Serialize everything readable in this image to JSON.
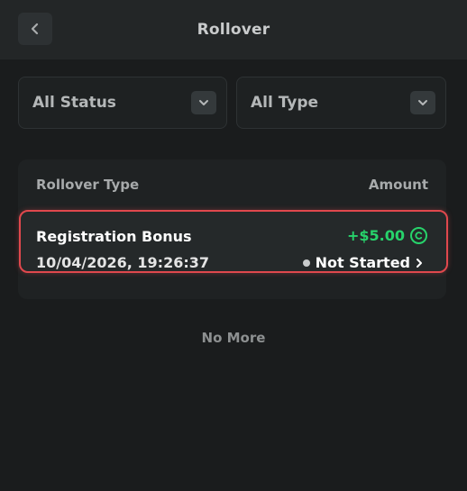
{
  "header": {
    "title": "Rollover",
    "back_icon": "chevron-left-icon"
  },
  "filters": {
    "status": {
      "value": "All Status",
      "icon": "chevron-down-icon"
    },
    "type": {
      "value": "All Type",
      "icon": "chevron-down-icon"
    }
  },
  "table": {
    "columns": [
      "Rollover Type",
      "Amount"
    ],
    "rows": [
      {
        "title": "Registration Bonus",
        "date": "10/04/2026, 19:26:37",
        "amount": "+$5.00",
        "status": "Not Started",
        "coin_icon": "bonus-coin-icon",
        "status_icon": "chevron-right-icon",
        "highlight_color": "#e0484d",
        "amount_color": "#27d36b"
      }
    ]
  },
  "footer": {
    "no_more": "No More"
  }
}
